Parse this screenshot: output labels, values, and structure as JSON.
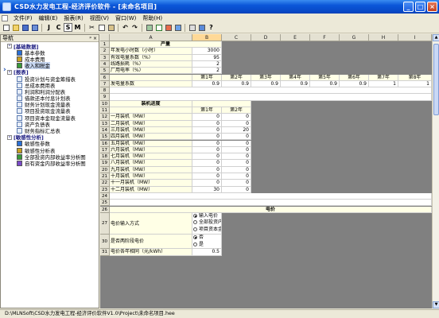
{
  "window": {
    "title": "CSD水力发电工程-经济评价软件 - [未命名项目]",
    "controls": [
      "_",
      "□",
      "×"
    ]
  },
  "menu": [
    {
      "label": "文件(F)"
    },
    {
      "label": "编辑(E)"
    },
    {
      "label": "报表(R)"
    },
    {
      "label": "视图(V)"
    },
    {
      "label": "窗口(W)"
    },
    {
      "label": "帮助(H)"
    }
  ],
  "toolbar": {
    "glyphs": [
      "J",
      "C",
      "S",
      "M"
    ]
  },
  "nav": {
    "header": "导航",
    "pin": "ᵖ ×",
    "groups": [
      {
        "label": "[基础数据]",
        "items": [
          "基本参数",
          "成本费用",
          "收入和税金"
        ]
      },
      {
        "label": "[报表]",
        "items": [
          "投资计划与资金筹措表",
          "总成本费用表",
          "利润和利润分配表",
          "借款还本付息计划表",
          "财务计划现金流量表",
          "项目投资现金流量表",
          "项目资本金现金流量表",
          "资产负债表",
          "财务指标汇总表"
        ]
      },
      {
        "label": "[敏感性分析]",
        "items": [
          "敏感性参数",
          "敏感性分析表",
          "全部投资内部收益率分析图",
          "自有资金内部收益率分析图"
        ]
      }
    ],
    "selected": "收入和税金"
  },
  "grid": {
    "columns": [
      "A",
      "B",
      "C",
      "D",
      "E",
      "F",
      "G",
      "H",
      "I"
    ],
    "row_numbers": [
      "1",
      "2",
      "3",
      "4",
      "5",
      "6",
      "7",
      "8",
      "9",
      "10",
      "11",
      "12",
      "13",
      "14",
      "15",
      "16",
      "17",
      "18",
      "19",
      "20",
      "21",
      "22",
      "23",
      "24",
      "25",
      "26",
      "27",
      "29",
      "30",
      "32",
      "31"
    ],
    "section1": {
      "title": "产量",
      "rows": [
        {
          "label": "年发电小时数（小时）",
          "value": "3000"
        },
        {
          "label": "有效电量系数（%）",
          "value": "95"
        },
        {
          "label": "线路损耗（%）",
          "value": "2"
        },
        {
          "label": "厂用电率（%）",
          "value": "2"
        }
      ],
      "year_headers": [
        "第1年",
        "第2年",
        "第3年",
        "第4年",
        "第5年",
        "第6年",
        "第7年",
        "第8年",
        "第"
      ],
      "gen_label": "发电量系数",
      "gen_values": [
        "0.9",
        "0.9",
        "0.9",
        "0.9",
        "0.9",
        "0.9",
        "1",
        "1",
        "1"
      ]
    },
    "section2": {
      "title": "装机进度",
      "year_headers": [
        "第1年",
        "第2年"
      ],
      "rows": [
        {
          "label": "一月装机（MW）",
          "v1": "0",
          "v2": "0"
        },
        {
          "label": "二月装机（MW）",
          "v1": "0",
          "v2": "0"
        },
        {
          "label": "三月装机（MW）",
          "v1": "0",
          "v2": "20"
        },
        {
          "label": "四月装机（MW）",
          "v1": "0",
          "v2": "0"
        },
        {
          "label": "五月装机（MW）",
          "v1": "0",
          "v2": "0"
        },
        {
          "label": "六月装机（MW）",
          "v1": "0",
          "v2": "0"
        },
        {
          "label": "七月装机（MW）",
          "v1": "0",
          "v2": "0"
        },
        {
          "label": "八月装机（MW）",
          "v1": "0",
          "v2": "0"
        },
        {
          "label": "九月装机（MW）",
          "v1": "0",
          "v2": "0"
        },
        {
          "label": "十月装机（MW）",
          "v1": "0",
          "v2": "0"
        },
        {
          "label": "十一月装机（MW）",
          "v1": "0",
          "v2": "0"
        },
        {
          "label": "十二月装机（MW）",
          "v1": "30",
          "v2": "0"
        }
      ]
    },
    "section3": {
      "title": "电价",
      "price_mode_label": "电价输入方式",
      "price_mode_options": [
        "输入电价",
        "全部投资内部",
        "项目资本金内"
      ],
      "price_mode_selected": 0,
      "two_part_label": "是否两阶段电价",
      "two_part_options": [
        "否",
        "是"
      ],
      "two_part_selected": 0,
      "price_label": "电价各年相同（元/kWh）",
      "price_value": "0.5"
    }
  },
  "status": {
    "path": "D:\\MLNSoft\\CSD水力发电工程-经济评价软件V1.0\\Project\\未命名项目.hee"
  }
}
